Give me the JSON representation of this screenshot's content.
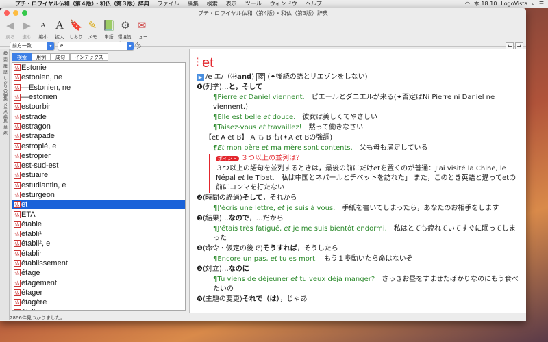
{
  "menubar": {
    "app": "プチ・ロワイヤル仏和（第４版）・和仏（第３版）辞典",
    "items": [
      "ファイル",
      "編集",
      "検索",
      "表示",
      "ツール",
      "ウィンドウ",
      "ヘルプ"
    ],
    "clock": "木 18:10",
    "vendor": "LogoVista"
  },
  "window": {
    "title": "プチ・ロワイヤル仏和（第4版）・和仏（第3版）辞典"
  },
  "toolbar": {
    "back": "戻る",
    "forward": "進む",
    "shrink": "縮小",
    "enlarge": "拡大",
    "bookmark": "しおり",
    "memo": "メモ",
    "wordbook": "単語",
    "settings": "環境設定",
    "news": "ニュース"
  },
  "search": {
    "mode": "前方一致",
    "query": "e"
  },
  "tabs": [
    "検索",
    "用例",
    "成句",
    "インデックス"
  ],
  "left_strip": [
    "検",
    "索",
    "履",
    "歴",
    "しおりの編集",
    "メモの編集",
    "単",
    "語"
  ],
  "list": {
    "items": [
      "Estonie",
      "estonien, ne",
      "―Estonien, ne",
      "―estonien",
      "estourbir",
      "estrade",
      "estragon",
      "estrapade",
      "estropié, e",
      "estropier",
      "est-sud-est",
      "estuaire",
      "estudiantin, e",
      "esturgeon",
      "et",
      "ETA",
      "étable",
      "établi¹",
      "établi², e",
      "établir",
      "établissement",
      "étage",
      "étagement",
      "étager",
      "étagère",
      "étai¹"
    ],
    "selected_index": 14,
    "badge": "仏"
  },
  "status": "2866件見つかりました。",
  "entry": {
    "headword": "et",
    "pron": "/e エ/（",
    "pron_and": "and",
    "pron_sym": "㊥",
    "pos": "接",
    "pos_note": "(✦後続の語とリエゾンをしない)",
    "s1_label": "❶(列挙)…",
    "s1_main": "と，そして",
    "ex1_fr_a": "¶Pierre ",
    "ex1_fr_et": "et",
    "ex1_fr_b": " Daniel viennent.",
    "ex1_ja": "ピエールとダニエルが来る(✦否定はNi Pierre ni Daniel ne viennent.)",
    "ex2_fr_a": "¶Elle est belle ",
    "ex2_fr_et": "et",
    "ex2_fr_b": " douce.",
    "ex2_ja": "彼女は美しくてやさしい",
    "ex3_fr_a": "¶Taisez-vous ",
    "ex3_fr_et": "et",
    "ex3_fr_b": " travaillez!",
    "ex3_ja": "黙って働きなさい",
    "pat": "【et A et B】 A も B も(✦A et Bの強調)",
    "ex4_fr_a": "¶Et",
    "ex4_fr_b": " mon père ",
    "ex4_fr_et": "et",
    "ex4_fr_c": " ma mère sont contents.",
    "ex4_ja": "父も母も満足している",
    "point_label": "ポイント",
    "point_head": "３つ以上の並列は？",
    "point_body_a": "３つ以上の語句を並列するときは，最後の前にだけetを置くのが普通：J'ai visité la Chine, le Népal ",
    "point_body_et": "et",
    "point_body_b": " le Tibet.「私は中国とネパールとチベットを訪れた」 また，このとき英語と違ってetの前にコンマを打たない",
    "s2_label": "❷(時間の経過)",
    "s2_main": "そして",
    "s2_rest": "，それから",
    "ex5_fr_a": "¶J'écris une lettre, ",
    "ex5_fr_et": "et",
    "ex5_fr_b": " je suis à vous.",
    "ex5_ja": "手紙を書いてしまったら，あなたのお相手をします",
    "s3_label": "❸(結果)…",
    "s3_main": "なので",
    "s3_rest": "，…だから",
    "ex6_fr_a": "¶J'étais très fatigué, ",
    "ex6_fr_et": "et",
    "ex6_fr_b": " je me suis bientôt endormi.",
    "ex6_ja": "私はとても疲れていてすぐに眠ってしまった",
    "s4_label": "❹(命令・仮定の後で)",
    "s4_main": "そうすれば",
    "s4_rest": "，そうしたら",
    "ex7_fr_a": "¶Encore un pas, ",
    "ex7_fr_et": "et",
    "ex7_fr_b": " tu es mort.",
    "ex7_ja": "もう１歩動いたら命はないぞ",
    "s5_label": "❺(対立)…",
    "s5_main": "なのに",
    "ex8_fr_a": "¶Tu viens de déjeuner ",
    "ex8_fr_et": "et",
    "ex8_fr_b": " tu veux déjà manger?",
    "ex8_ja": "さっきお昼をすませたばかりなのにもう食べたいの",
    "s6_label": "❻(主題の変更)",
    "s6_main": "それで（は）",
    "s6_rest": "，じゃあ"
  }
}
